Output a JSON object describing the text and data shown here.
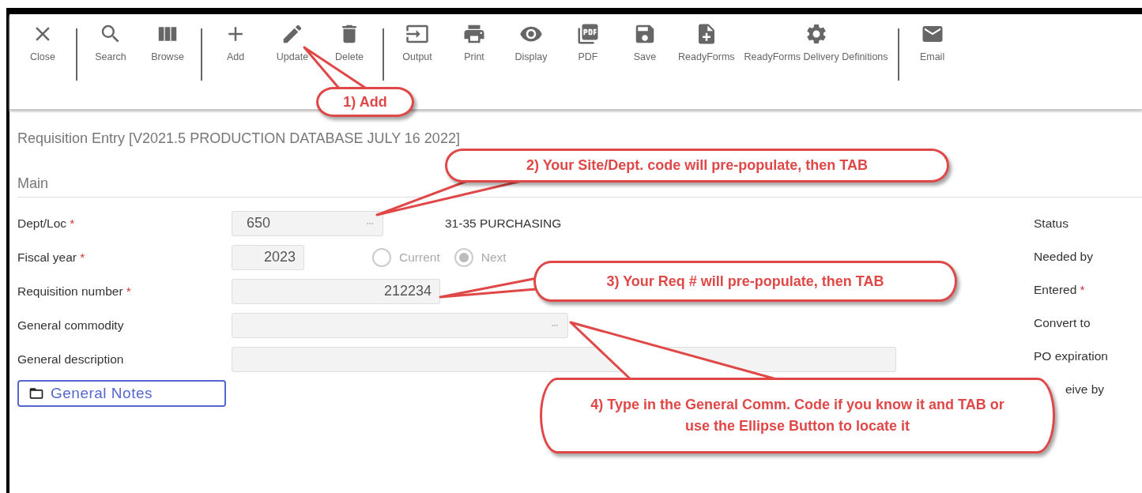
{
  "toolbar": {
    "groups": [
      [
        {
          "label": "Close"
        }
      ],
      [
        {
          "label": "Search"
        },
        {
          "label": "Browse"
        }
      ],
      [
        {
          "label": "Add"
        },
        {
          "label": "Update"
        },
        {
          "label": "Delete"
        }
      ],
      [
        {
          "label": "Output"
        },
        {
          "label": "Print"
        },
        {
          "label": "Display"
        },
        {
          "label": "PDF"
        },
        {
          "label": "Save"
        },
        {
          "label": "ReadyForms"
        },
        {
          "label": "ReadyForms Delivery Definitions"
        }
      ],
      [
        {
          "label": "Email"
        }
      ]
    ]
  },
  "page_title": "Requisition Entry [V2021.5 PRODUCTION DATABASE JULY 16 2022]",
  "section": "Main",
  "fields": [
    {
      "label": "Dept/Loc",
      "required_mark": "*",
      "value": "650",
      "lookup": true,
      "after_text": "31-35 PURCHASING"
    },
    {
      "label": "Fiscal year",
      "required_mark": "*",
      "value": "2023",
      "lookup": false,
      "options": [
        {
          "label": "Current",
          "selected": false
        },
        {
          "label": "Next",
          "selected": true
        }
      ]
    },
    {
      "label": "Requisition number",
      "required_mark": "*",
      "value": "212234",
      "lookup": false
    },
    {
      "label": "General commodity",
      "lookup": true
    },
    {
      "label": "General description",
      "lookup": false
    }
  ],
  "notes_button": "General Notes",
  "side_labels": [
    {
      "label": "Status"
    },
    {
      "label": "Needed by"
    },
    {
      "label": "Entered",
      "required_mark": "*"
    },
    {
      "label": "Convert to"
    },
    {
      "label": "PO expiration"
    },
    {
      "label": "eive by"
    }
  ],
  "callouts": [
    {
      "text": "1) Add"
    },
    {
      "text": "2) Your Site/Dept. code will pre-populate, then TAB"
    },
    {
      "text": "3) Your Req # will pre-populate, then TAB"
    },
    {
      "text": "4) Type in the General Comm. Code if you know it and TAB or use the Ellipse Button to locate it"
    }
  ]
}
